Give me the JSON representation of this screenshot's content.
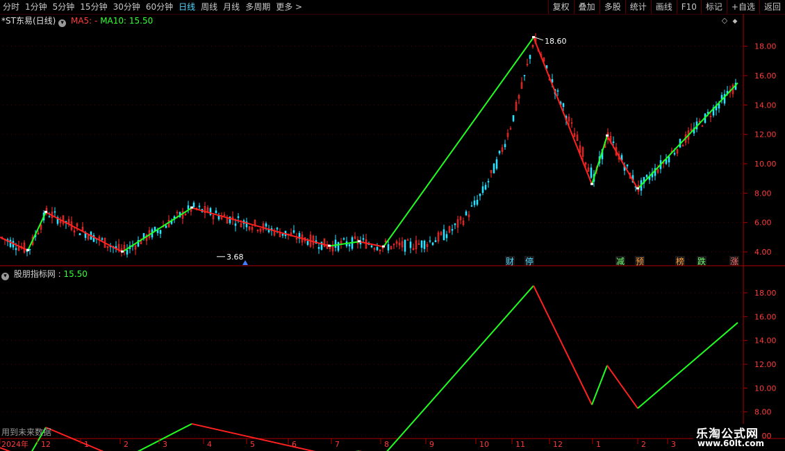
{
  "toolbar": {
    "left_items": [
      "分时",
      "1分钟",
      "5分钟",
      "15分钟",
      "30分钟",
      "60分钟",
      "日线",
      "周线",
      "月线",
      "多周期",
      "更多 >"
    ],
    "active_index": 6,
    "right_items": [
      "复权",
      "叠加",
      "多股",
      "统计",
      "画线",
      "F10",
      "标记",
      "+自选",
      "返回"
    ]
  },
  "upper_panel": {
    "title": "*ST东易(日线)",
    "ma5_label": "MA5: -",
    "ma10_label": "MA10: 15.50",
    "ma5_color": "#ff3b3b",
    "ma10_color": "#34ff34",
    "high_label": "18.60",
    "low_label": "3.68",
    "events": [
      "财",
      "停",
      "减",
      "预",
      "榜",
      "跌",
      "涨"
    ],
    "event_colors": [
      "#4fd6ff",
      "#4fd6ff",
      "#6cff6c",
      "#ff9c3c",
      "#ff9c3c",
      "#6cff6c",
      "#ff6c6c"
    ]
  },
  "lower_panel": {
    "title": "股朋指标网",
    "value": "15.50"
  },
  "x_axis": {
    "labels": [
      "2024年",
      "12",
      "1",
      "2",
      "3",
      "4",
      "5",
      "6",
      "7",
      "8",
      "9",
      "10",
      "11",
      "12",
      "1",
      "2",
      "3"
    ]
  },
  "future_note": "用到未来数据",
  "watermark": {
    "line1": "乐淘公式网",
    "line2": "www.60lt.com"
  },
  "chart_data": [
    {
      "type": "line",
      "name": "upper zigzag over daily candles",
      "ylim": [
        3.2,
        19.4
      ],
      "y_ticks": [
        "18.00",
        "16.00",
        "14.00",
        "12.00",
        "10.00",
        "8.00",
        "6.00",
        "4.00"
      ],
      "x": [
        0,
        40,
        66,
        176,
        276,
        474,
        517,
        552,
        768,
        852,
        874,
        918,
        1062
      ],
      "zigzag": [
        5.0,
        4.1,
        6.7,
        4.0,
        7.0,
        4.4,
        4.7,
        4.35,
        18.6,
        8.6,
        11.9,
        8.3,
        15.5
      ],
      "segment_colors": [
        "red",
        "green",
        "red",
        "green",
        "red",
        "green",
        "red",
        "green",
        "red",
        "green",
        "red",
        "green"
      ],
      "high": 18.6,
      "low": 3.68
    },
    {
      "type": "line",
      "name": "lower indicator",
      "ylim": [
        6.0,
        19.4
      ],
      "y_ticks": [
        "18.00",
        "16.00",
        "14.00",
        "12.00",
        "10.00",
        "8.00",
        "6.00"
      ],
      "x": [
        0,
        40,
        66,
        176,
        276,
        474,
        517,
        552,
        768,
        852,
        874,
        918,
        1062
      ],
      "values": [
        5.0,
        4.1,
        6.7,
        4.0,
        7.0,
        4.4,
        4.7,
        4.35,
        18.6,
        8.6,
        11.9,
        8.3,
        15.5
      ],
      "segment_colors": [
        "red",
        "green",
        "red",
        "green",
        "red",
        "green",
        "red",
        "green",
        "red",
        "green",
        "red",
        "green"
      ],
      "last_value": 15.5
    }
  ]
}
